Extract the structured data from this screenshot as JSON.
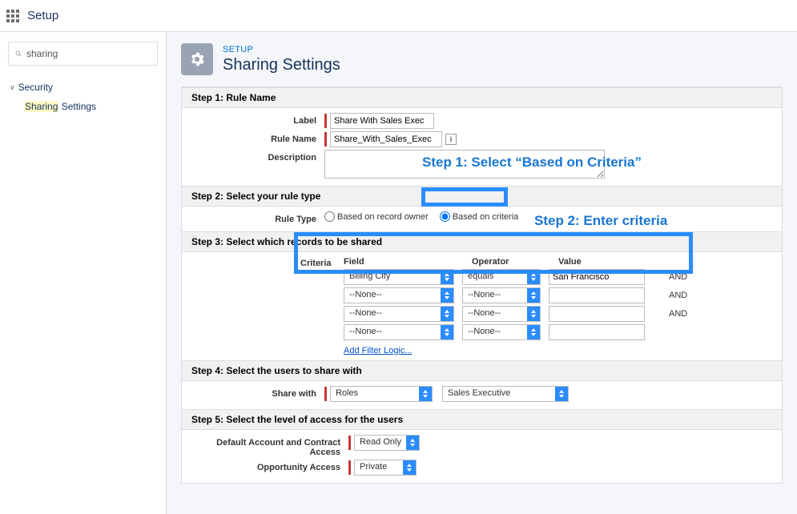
{
  "topbar": {
    "label": "Setup"
  },
  "sidebar": {
    "search": "sharing",
    "section": "Security",
    "item_prefix": "Sharing",
    "item_suffix": " Settings"
  },
  "header": {
    "eyebrow": "SETUP",
    "title": "Sharing Settings"
  },
  "step1": {
    "title": "Step 1: Rule Name",
    "label_field": "Label",
    "label_value": "Share With Sales Exec",
    "rulename_field": "Rule Name",
    "rulename_value": "Share_With_Sales_Exec",
    "description_field": "Description"
  },
  "step2": {
    "title": "Step 2: Select your rule type",
    "ruletype_field": "Rule Type",
    "option1": "Based on record owner",
    "option2": "Based on criteria"
  },
  "step3": {
    "title": "Step 3: Select which records to be shared",
    "criteria_label": "Criteria",
    "col_field": "Field",
    "col_operator": "Operator",
    "col_value": "Value",
    "and": "AND",
    "rows": [
      {
        "field": "Billing City",
        "operator": "equals",
        "value": "San Francisco"
      },
      {
        "field": "--None--",
        "operator": "--None--",
        "value": ""
      },
      {
        "field": "--None--",
        "operator": "--None--",
        "value": ""
      },
      {
        "field": "--None--",
        "operator": "--None--",
        "value": ""
      }
    ],
    "filter_link": "Add Filter Logic..."
  },
  "step4": {
    "title": "Step 4: Select the users to share with",
    "sharewith_field": "Share with",
    "category": "Roles",
    "value": "Sales Executive"
  },
  "step5": {
    "title": "Step 5: Select the level of access for the users",
    "row1_label": "Default Account and Contract Access",
    "row1_value": "Read Only",
    "row2_label": "Opportunity Access",
    "row2_value": "Private"
  },
  "annotations": {
    "a1": "Step 1: Select “Based on Criteria”",
    "a2": "Step 2: Enter criteria"
  }
}
